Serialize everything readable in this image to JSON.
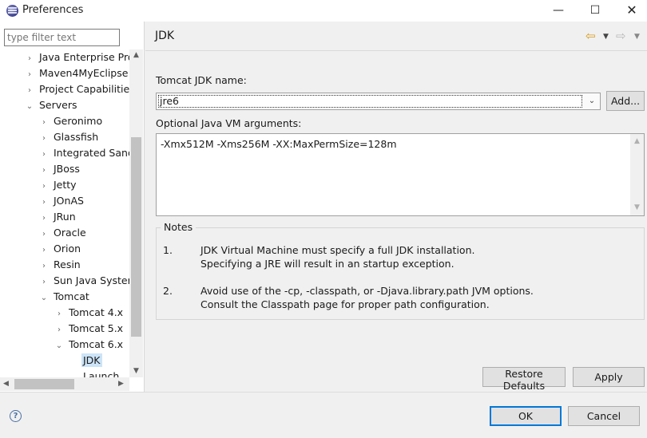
{
  "window": {
    "title": "Preferences"
  },
  "filter": {
    "placeholder": "type filter text"
  },
  "tree": [
    {
      "label": "Java Enterprise Pro",
      "chevron": "›"
    },
    {
      "label": "Maven4MyEclipse",
      "chevron": "›"
    },
    {
      "label": "Project Capabilities",
      "chevron": "›"
    },
    {
      "label": "Servers",
      "chevron": "⌄"
    },
    {
      "label": "Geronimo",
      "chevron": "›"
    },
    {
      "label": "Glassfish",
      "chevron": "›"
    },
    {
      "label": "Integrated Sand",
      "chevron": "›"
    },
    {
      "label": "JBoss",
      "chevron": "›"
    },
    {
      "label": "Jetty",
      "chevron": "›"
    },
    {
      "label": "JOnAS",
      "chevron": "›"
    },
    {
      "label": "JRun",
      "chevron": "›"
    },
    {
      "label": "Oracle",
      "chevron": "›"
    },
    {
      "label": "Orion",
      "chevron": "›"
    },
    {
      "label": "Resin",
      "chevron": "›"
    },
    {
      "label": "Sun Java System",
      "chevron": "›"
    },
    {
      "label": "Tomcat",
      "chevron": "⌄"
    },
    {
      "label": "Tomcat  4.x",
      "chevron": "›"
    },
    {
      "label": "Tomcat  5.x",
      "chevron": "›"
    },
    {
      "label": "Tomcat  6.x",
      "chevron": "⌄"
    },
    {
      "label": "JDK",
      "chevron": ""
    },
    {
      "label": "Launch",
      "chevron": ""
    }
  ],
  "page": {
    "title": "JDK",
    "jdk_name_label": "Tomcat JDK name:",
    "jdk_name_value": "jre6",
    "add_button": "Add...",
    "vm_args_label": "Optional Java VM arguments:",
    "vm_args_value": "-Xmx512M -Xms256M -XX:MaxPermSize=128m",
    "notes_title": "Notes",
    "notes": [
      {
        "num": "1.",
        "line1": "JDK Virtual Machine must specify a full JDK installation.",
        "line2": "Specifying a JRE will result in an startup exception."
      },
      {
        "num": "2.",
        "line1": "Avoid use of the -cp, -classpath, or -Djava.library.path JVM options.",
        "line2": "Consult the Classpath page for proper path configuration."
      }
    ],
    "restore_defaults": "Restore Defaults",
    "apply": "Apply"
  },
  "footer": {
    "ok": "OK",
    "cancel": "Cancel"
  },
  "icons": {
    "app": "eclipse-icon",
    "help": "help-icon",
    "back": "back-arrow-icon",
    "forward": "forward-arrow-icon"
  },
  "colors": {
    "selection": "#cce4f7",
    "default_button_border": "#0078d7",
    "back_arrow": "#d79a1a"
  }
}
